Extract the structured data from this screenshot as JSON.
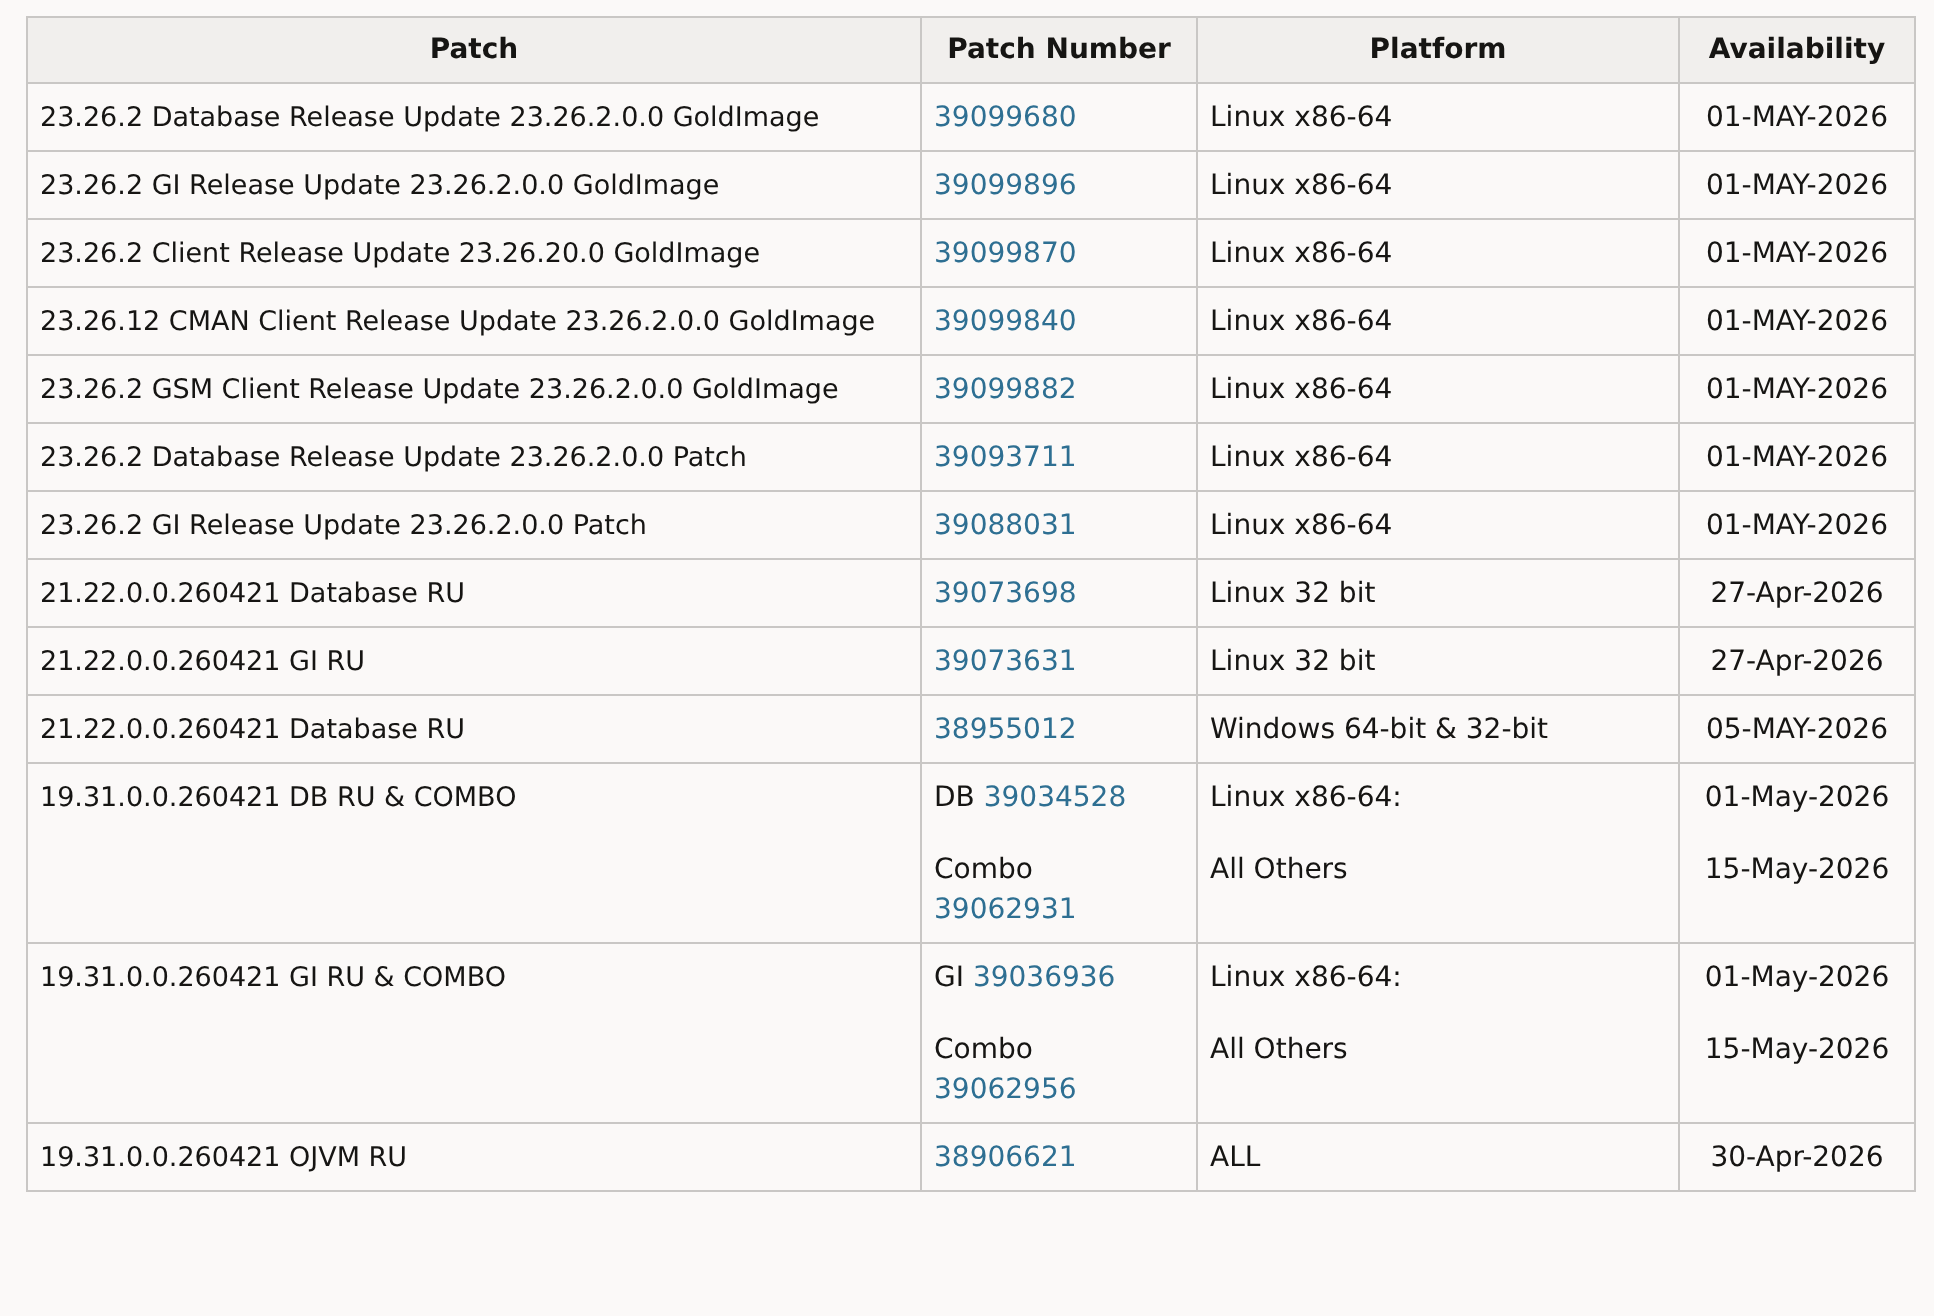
{
  "table": {
    "columns": [
      "Patch",
      "Patch Number",
      "Platform",
      "Availability"
    ],
    "rows": [
      {
        "patch": "23.26.2 Database Release Update 23.26.2.0.0 GoldImage",
        "patch_numbers": [
          {
            "number": "39099680"
          }
        ],
        "platforms": [
          "Linux x86-64"
        ],
        "availability": [
          "01-MAY-2026"
        ]
      },
      {
        "patch": "23.26.2 GI Release Update 23.26.2.0.0 GoldImage",
        "patch_numbers": [
          {
            "number": "39099896"
          }
        ],
        "platforms": [
          "Linux x86-64"
        ],
        "availability": [
          "01-MAY-2026"
        ]
      },
      {
        "patch": "23.26.2 Client Release Update 23.26.20.0 GoldImage",
        "patch_numbers": [
          {
            "number": "39099870"
          }
        ],
        "platforms": [
          "Linux x86-64"
        ],
        "availability": [
          "01-MAY-2026"
        ]
      },
      {
        "patch": "23.26.12 CMAN Client Release Update 23.26.2.0.0 GoldImage",
        "patch_numbers": [
          {
            "number": "39099840"
          }
        ],
        "platforms": [
          "Linux x86-64"
        ],
        "availability": [
          "01-MAY-2026"
        ]
      },
      {
        "patch": "23.26.2 GSM Client Release Update 23.26.2.0.0 GoldImage",
        "patch_numbers": [
          {
            "number": "39099882"
          }
        ],
        "platforms": [
          "Linux x86-64"
        ],
        "availability": [
          "01-MAY-2026"
        ]
      },
      {
        "patch": "23.26.2 Database Release Update 23.26.2.0.0 Patch",
        "patch_numbers": [
          {
            "number": "39093711"
          }
        ],
        "platforms": [
          "Linux x86-64"
        ],
        "availability": [
          "01-MAY-2026"
        ]
      },
      {
        "patch": "23.26.2 GI Release Update 23.26.2.0.0 Patch",
        "patch_numbers": [
          {
            "number": "39088031"
          }
        ],
        "platforms": [
          "Linux x86-64"
        ],
        "availability": [
          "01-MAY-2026"
        ]
      },
      {
        "patch": "21.22.0.0.260421 Database RU",
        "patch_numbers": [
          {
            "number": "39073698"
          }
        ],
        "platforms": [
          "Linux 32 bit"
        ],
        "availability": [
          "27-Apr-2026"
        ]
      },
      {
        "patch": "21.22.0.0.260421 GI RU",
        "patch_numbers": [
          {
            "number": "39073631"
          }
        ],
        "platforms": [
          "Linux 32 bit"
        ],
        "availability": [
          "27-Apr-2026"
        ]
      },
      {
        "patch": "21.22.0.0.260421 Database RU",
        "patch_numbers": [
          {
            "number": "38955012"
          }
        ],
        "platforms": [
          "Windows 64-bit & 32-bit"
        ],
        "availability": [
          "05-MAY-2026"
        ]
      },
      {
        "patch": "19.31.0.0.260421 DB RU & COMBO",
        "patch_numbers": [
          {
            "kind": "inline",
            "label": "DB",
            "number": "39034528"
          },
          {
            "kind": "stacked",
            "label": "Combo",
            "number": "39062931"
          }
        ],
        "platforms": [
          "Linux x86-64:",
          "All Others"
        ],
        "availability": [
          "01-May-2026",
          "15-May-2026"
        ]
      },
      {
        "patch": "19.31.0.0.260421 GI RU & COMBO",
        "patch_numbers": [
          {
            "kind": "inline",
            "label": "GI",
            "number": "39036936"
          },
          {
            "kind": "stacked",
            "label": "Combo",
            "number": "39062956"
          }
        ],
        "platforms": [
          "Linux x86-64:",
          "All Others"
        ],
        "availability": [
          "01-May-2026",
          "15-May-2026"
        ]
      },
      {
        "patch": "19.31.0.0.260421 OJVM RU",
        "patch_numbers": [
          {
            "number": "38906621"
          }
        ],
        "platforms": [
          "ALL"
        ],
        "availability": [
          "30-Apr-2026"
        ]
      }
    ]
  }
}
